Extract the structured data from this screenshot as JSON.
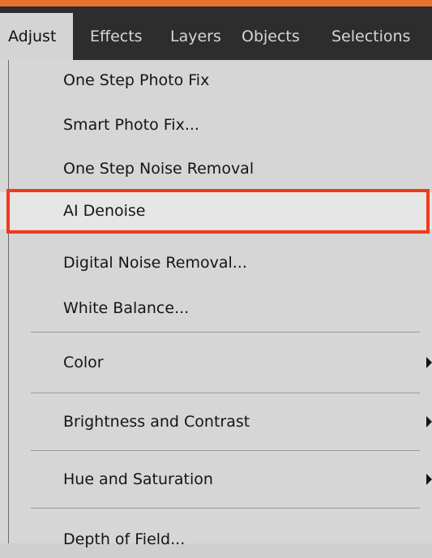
{
  "menubar": {
    "items": [
      {
        "label": "Adjust",
        "active": true
      },
      {
        "label": "Effects"
      },
      {
        "label": "Layers"
      },
      {
        "label": "Objects"
      },
      {
        "label": "Selections"
      }
    ]
  },
  "adjust_menu": {
    "items": [
      {
        "label": "One Step Photo Fix"
      },
      {
        "label": "Smart Photo Fix..."
      },
      {
        "label": "One Step Noise Removal"
      },
      {
        "label": "AI Denoise",
        "highlighted": true
      },
      {
        "label": "Digital Noise Removal..."
      },
      {
        "label": "White Balance..."
      },
      {
        "label": "Color",
        "has_submenu": true
      },
      {
        "label": "Brightness and Contrast",
        "has_submenu": true
      },
      {
        "label": "Hue and Saturation",
        "has_submenu": true
      },
      {
        "label": "Depth of Field..."
      }
    ]
  },
  "colors": {
    "menubar_bg": "#2d2d2d",
    "accent_orange": "#e8722f",
    "menu_bg": "#d6d6d6",
    "highlight_border": "#f03a1c"
  },
  "icons": {
    "submenu": "submenu-arrow-icon"
  }
}
